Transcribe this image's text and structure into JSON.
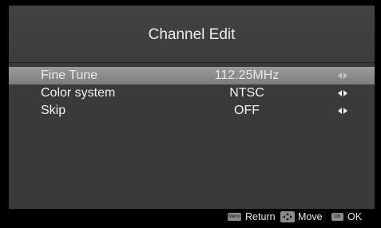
{
  "title": "Channel Edit",
  "items": [
    {
      "label": "Fine Tune",
      "value": "112.25MHz",
      "selected": true
    },
    {
      "label": "Color system",
      "value": "NTSC",
      "selected": false
    },
    {
      "label": "Skip",
      "value": "OFF",
      "selected": false
    }
  ],
  "footer": {
    "menu_key": "Menu",
    "return_label": "Return",
    "move_label": "Move",
    "ok_key": "OK",
    "ok_label": "OK"
  },
  "colors": {
    "panel": "#3a3a3a",
    "highlight": "#8c8c8c",
    "footer": "#000000"
  }
}
